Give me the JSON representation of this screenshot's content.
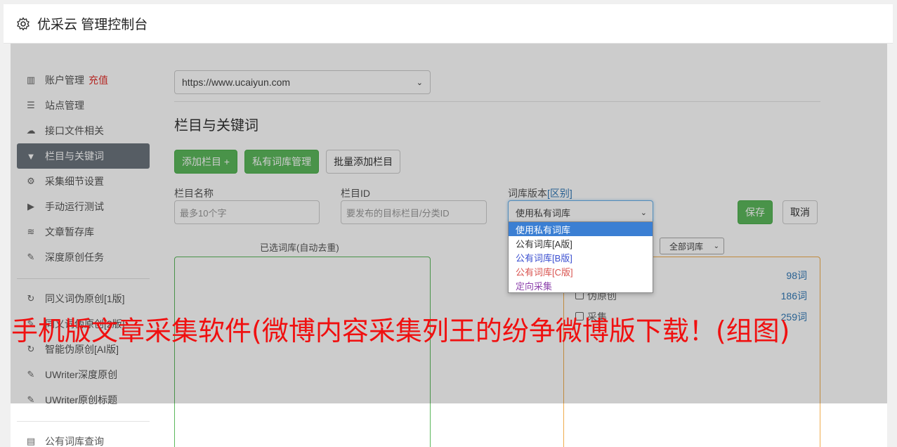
{
  "header": {
    "title": "优采云 管理控制台"
  },
  "sidebar": {
    "group1": [
      {
        "label": "账户管理",
        "badge": "充值",
        "icon": "bar-chart-icon"
      },
      {
        "label": "站点管理",
        "icon": "server-icon"
      },
      {
        "label": "接口文件相关",
        "icon": "cloud-upload-icon"
      },
      {
        "label": "栏目与关键词",
        "icon": "filter-icon",
        "active": true
      },
      {
        "label": "采集细节设置",
        "icon": "cogs-icon"
      },
      {
        "label": "手动运行测试",
        "icon": "play-circle-icon"
      },
      {
        "label": "文章暂存库",
        "icon": "database-icon"
      },
      {
        "label": "深度原创任务",
        "icon": "edit-icon"
      }
    ],
    "group2": [
      {
        "label": "同义词伪原创[1版]",
        "icon": "refresh-icon"
      },
      {
        "label": "同义词伪原创[2版]",
        "icon": "edit-icon"
      },
      {
        "label": "智能伪原创[AI版]",
        "icon": "refresh-icon"
      },
      {
        "label": "UWriter深度原创",
        "icon": "edit-icon"
      },
      {
        "label": "UWriter原创标题",
        "icon": "edit-icon"
      }
    ],
    "group3": [
      {
        "label": "公有词库查询",
        "icon": "book-icon"
      }
    ]
  },
  "main": {
    "site_select": "https://www.ucaiyun.com",
    "section_title": "栏目与关键词",
    "buttons": {
      "add_column": "添加栏目 +",
      "private_lib": "私有词库管理",
      "batch_add": "批量添加栏目"
    },
    "form": {
      "name_label": "栏目名称",
      "name_placeholder": "最多10个字",
      "id_label": "栏目ID",
      "id_placeholder": "要发布的目标栏目/分类ID",
      "version_label": "词库版本",
      "version_link": "[区别]",
      "version_value": "使用私有词库",
      "save": "保存",
      "cancel": "取消"
    },
    "dropdown_options": [
      {
        "label": "使用私有词库",
        "color": "#ffffff",
        "selected": true
      },
      {
        "label": "公有词库[A版]",
        "color": "#333333"
      },
      {
        "label": "公有词库[B版]",
        "color": "#3b4fd0"
      },
      {
        "label": "公有词库[C版]",
        "color": "#d9534f"
      },
      {
        "label": "定向采集",
        "color": "#8e44ad"
      }
    ],
    "selected_lib_label": "已选词库(自动去重)",
    "all_lib_select": "全部词库",
    "libs": [
      {
        "name": "",
        "count": "98词"
      },
      {
        "name": "伪原创",
        "count": "186词"
      },
      {
        "name": "采集",
        "count": "259词"
      }
    ]
  },
  "banner": "手机版文章采集软件(微博内容采集列王的纷争微博版下载！(组图)"
}
